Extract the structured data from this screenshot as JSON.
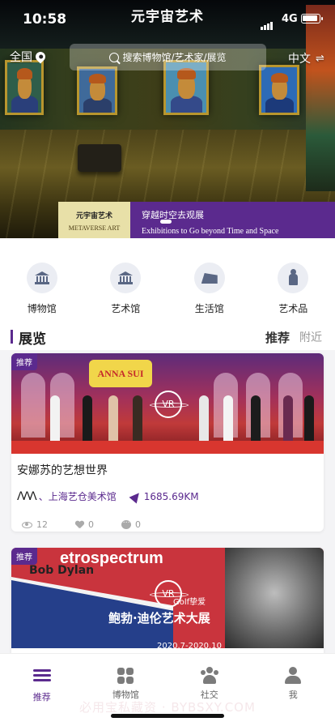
{
  "status": {
    "time": "10:58",
    "network": "4G"
  },
  "app_title": "元宇宙艺术",
  "header": {
    "location": "全国",
    "search_placeholder": "搜索博物馆/艺术家/展览",
    "language": "中文",
    "lang_switch_icon": "⇌"
  },
  "banner": {
    "left_line1": "元宇宙艺术",
    "left_line2": "METAVERSE ART",
    "right_line1": "穿越时空去观展",
    "right_line2": "Exhibitions to Go beyond Time and Space"
  },
  "categories": [
    {
      "label": "博物馆",
      "icon": "museum-icon"
    },
    {
      "label": "艺术馆",
      "icon": "gallery-icon"
    },
    {
      "label": "生活馆",
      "icon": "lifestyle-icon"
    },
    {
      "label": "艺术品",
      "icon": "artwork-icon"
    }
  ],
  "section": {
    "title": "展览",
    "tab_recommended": "推荐",
    "tab_nearby": "附近"
  },
  "cards": [
    {
      "badge": "推荐",
      "vr_label": "VR",
      "image_sign": "ANNA SUI",
      "name": "安娜苏的艺想世界",
      "venue_prefix": "、",
      "venue": "上海艺仓美术馆",
      "distance": "1685.69KM",
      "views": "12",
      "likes": "0",
      "comments": "0"
    },
    {
      "badge": "推荐",
      "vr_label": "VR",
      "image_title": "etrospectrum",
      "image_subtitle": "Bob Dylan",
      "image_caption": "鲍勃·迪伦艺术大展",
      "image_note": "Golf挚爱",
      "image_date": "2020.7-2020.10",
      "name": "鲍勃·迪伦艺术大展"
    }
  ],
  "tabs": [
    {
      "label": "推荐",
      "icon": "list-icon",
      "active": true
    },
    {
      "label": "博物馆",
      "icon": "grid-icon",
      "active": false
    },
    {
      "label": "社交",
      "icon": "people-icon",
      "active": false
    },
    {
      "label": "我",
      "icon": "profile-icon",
      "active": false
    }
  ],
  "watermark": "必用宝私藏资 · BYBSXY.COM",
  "colors": {
    "accent": "#5b2a8e",
    "banner_left_bg": "#e8e0a8",
    "muted": "#999999"
  }
}
